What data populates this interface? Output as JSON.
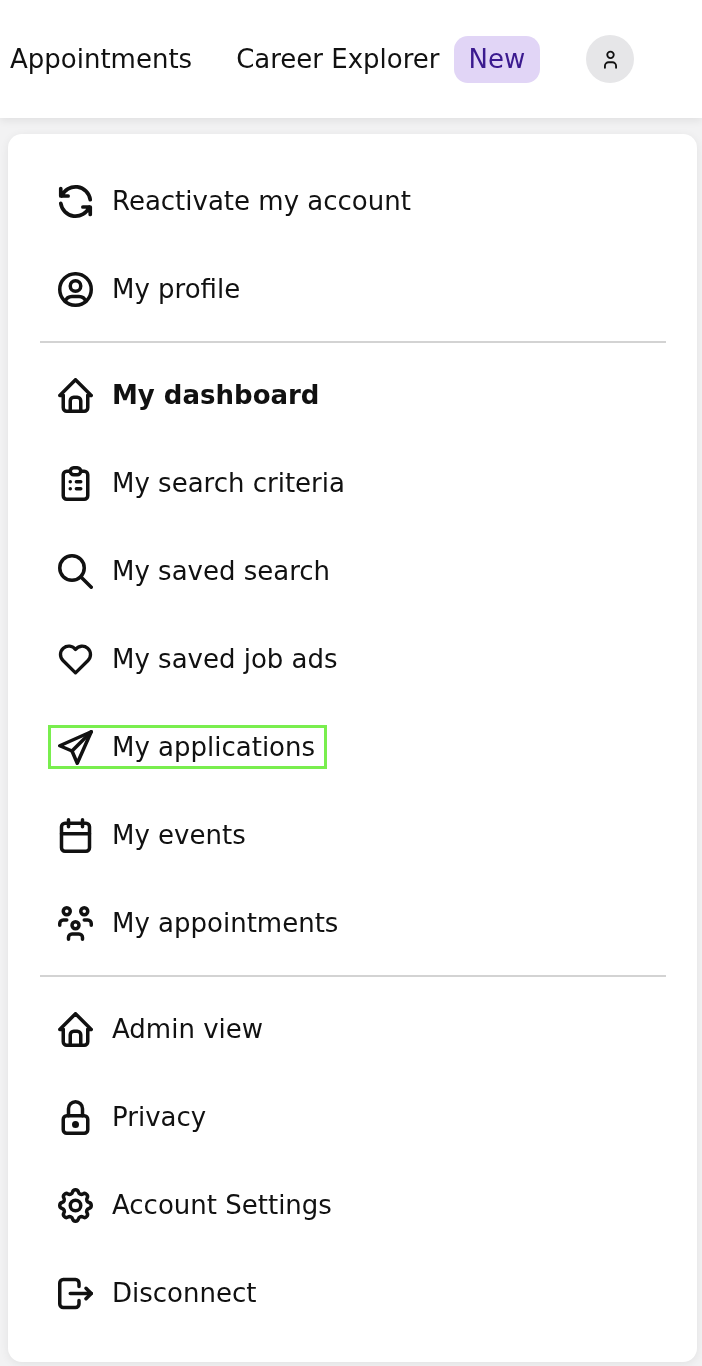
{
  "header": {
    "nav_links": [
      {
        "label": "Appointments"
      },
      {
        "label": "Career Explorer",
        "badge": "New"
      }
    ]
  },
  "account_menu": {
    "groups": [
      {
        "items": [
          {
            "label": "Reactivate my account",
            "kind": "refresh",
            "current": false,
            "highlighted": false
          },
          {
            "label": "My profile",
            "kind": "profile",
            "current": false,
            "highlighted": false
          }
        ]
      },
      {
        "items": [
          {
            "label": "My dashboard",
            "kind": "home",
            "current": true,
            "highlighted": false
          },
          {
            "label": "My search criteria",
            "kind": "clipboard",
            "current": false,
            "highlighted": false
          },
          {
            "label": "My saved search",
            "kind": "search",
            "current": false,
            "highlighted": false
          },
          {
            "label": "My saved job ads",
            "kind": "heart",
            "current": false,
            "highlighted": false
          },
          {
            "label": "My applications",
            "kind": "send",
            "current": false,
            "highlighted": true
          },
          {
            "label": "My events",
            "kind": "calendar",
            "current": false,
            "highlighted": false
          },
          {
            "label": "My appointments",
            "kind": "people",
            "current": false,
            "highlighted": false
          }
        ]
      },
      {
        "items": [
          {
            "label": "Admin view",
            "kind": "home",
            "current": false,
            "highlighted": false
          },
          {
            "label": "Privacy",
            "kind": "lock",
            "current": false,
            "highlighted": false
          },
          {
            "label": "Account Settings",
            "kind": "gear",
            "current": false,
            "highlighted": false
          },
          {
            "label": "Disconnect",
            "kind": "logout",
            "current": false,
            "highlighted": false
          }
        ]
      }
    ]
  }
}
